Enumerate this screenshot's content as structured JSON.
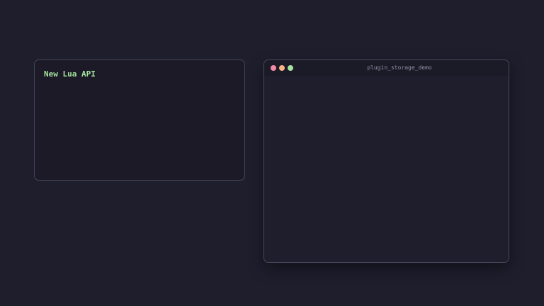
{
  "info_panel": {
    "title": "New Lua API"
  },
  "terminal": {
    "title": "plugin_storage_demo",
    "controls": {
      "close_color": "#f38ba8",
      "minimize_color": "#fab387",
      "maximize_color": "#a6e3a1"
    }
  },
  "colors": {
    "background": "#1f1e2d",
    "accent_green": "#a6e3a1",
    "border": "#45455a"
  }
}
